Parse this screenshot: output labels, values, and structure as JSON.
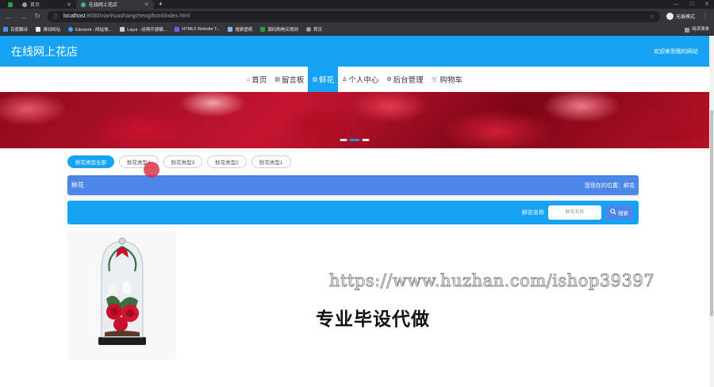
{
  "browser": {
    "tabs": [
      {
        "label": "首页"
      },
      {
        "label": "在线网上花店",
        "active": true
      }
    ],
    "url_host": "localhost",
    "url_path": ":8080/xianhuashangcheng/front/index.html",
    "profile_label": "无痕模式",
    "bookmarks": [
      "百度翻译",
      "滑动网站",
      "Element - 网站快...",
      "Layui - 经典开源模...",
      "HTML5 Website T...",
      "搜索壁纸",
      "源码购物买规则",
      "首页"
    ],
    "bookmarks_right": "阅读清单"
  },
  "header": {
    "title": "在线网上花店",
    "welcome": "欢迎来到我的网站"
  },
  "nav": [
    {
      "icon": "⌂",
      "label": "首页",
      "active": false
    },
    {
      "icon": "▤",
      "label": "留言板",
      "active": false
    },
    {
      "icon": "▥",
      "label": "鲜花",
      "active": true
    },
    {
      "icon": "♙",
      "label": "个人中心",
      "active": false
    },
    {
      "icon": "⚙",
      "label": "后台管理",
      "active": false
    },
    {
      "icon": "🛒",
      "label": "购物车",
      "active": false
    }
  ],
  "types": [
    {
      "label": "鲜花类型全部",
      "active": true
    },
    {
      "label": "鲜花类型4",
      "active": false
    },
    {
      "label": "鲜花类型3",
      "active": false
    },
    {
      "label": "鲜花类型2",
      "active": false
    },
    {
      "label": "鲜花类型1",
      "active": false
    }
  ],
  "crumb": {
    "title": "鲜花",
    "position": "您现在的位置：鲜花"
  },
  "search": {
    "label": "鲜花名称",
    "placeholder": "鲜花名称",
    "button": "搜索"
  },
  "watermark": "https://www.huzhan.com/ishop39397",
  "overlay_text": "专业毕设代做",
  "colors": {
    "primary": "#16a3f3",
    "secondary": "#4b86e8"
  }
}
